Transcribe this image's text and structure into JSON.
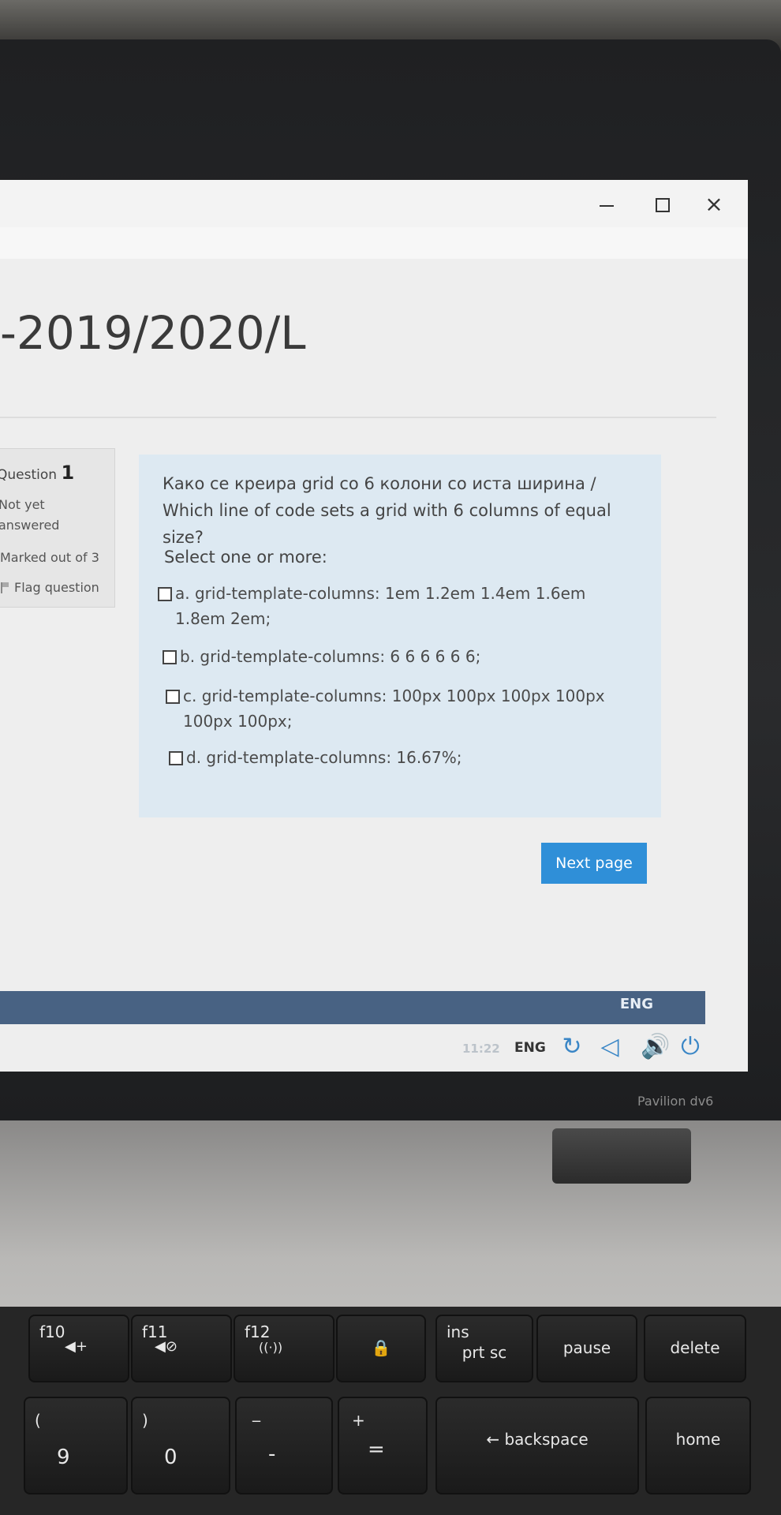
{
  "window": {
    "minimize_icon": "minimize-icon",
    "maximize_icon": "maximize-icon",
    "close_icon": "close-icon",
    "close_label": "×"
  },
  "course": {
    "title": "-2019/2020/L"
  },
  "question_info": {
    "label": "Question",
    "number": "1",
    "state_line1": "Not yet",
    "state_line2": "answered",
    "marks": "Marked out of 3",
    "flag_label": "Flag question"
  },
  "question": {
    "text": "Како се креира grid со 6 колони со иста ширина / Which line of code sets a grid with 6 columns of equal size?",
    "prompt": "Select one or more:",
    "options": [
      {
        "label": "a. grid-template-columns: 1em 1.2em 1.4em 1.6em 1.8em 2em;",
        "checked": false
      },
      {
        "label": "b. grid-template-columns: 6 6 6 6 6 6;",
        "checked": false
      },
      {
        "label": "c. grid-template-columns: 100px 100px 100px 100px 100px 100px;",
        "checked": false
      },
      {
        "label": "d. grid-template-columns: 16.67%;",
        "checked": false
      }
    ]
  },
  "navigation": {
    "next_label": "Next page"
  },
  "taskbar": {
    "lang_band": "ENG",
    "time": "11:22",
    "lang": "ENG"
  },
  "device": {
    "brand": "Pavilion dv6"
  },
  "keyboard": {
    "f10": "f10",
    "f11": "f11",
    "f12": "f12",
    "ins": "ins",
    "prt_sc": "prt sc",
    "pause": "pause",
    "delete": "delete",
    "nine_top": "(",
    "nine": "9",
    "zero_top": ")",
    "zero": "0",
    "minus_top": "_",
    "minus": "-",
    "equals_top": "+",
    "equals": "=",
    "backspace": "← backspace",
    "home": "home"
  },
  "colors": {
    "accent": "#2f8fd8",
    "question_bg": "#dde9f2",
    "taskbar_band": "#486283"
  }
}
